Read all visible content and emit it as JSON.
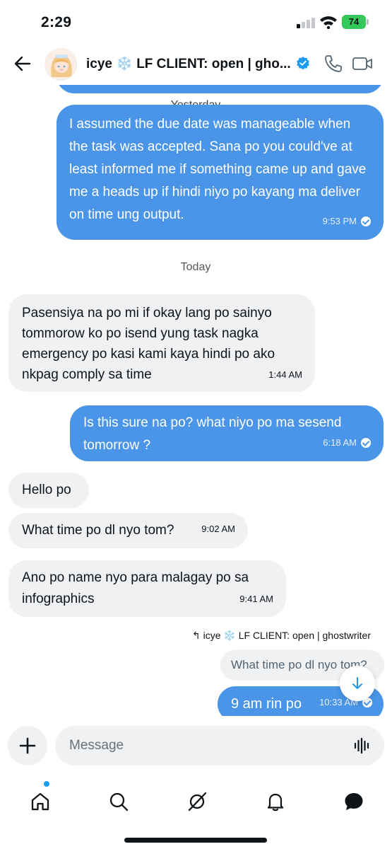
{
  "status": {
    "time": "2:29",
    "battery": "74"
  },
  "header": {
    "name": "icye ❄️ LF CLIENT: open | gho...",
    "back_label": "Back"
  },
  "dividers": {
    "yesterday": "Yesterday",
    "today": "Today"
  },
  "messages": [
    {
      "side": "out",
      "text": "I assumed the due date was manageable when the task was accepted. Sana po you could've at least informed me if something came up and gave me a heads up if hindi niyo po kayang ma deliver on time ung output.",
      "time": "9:53 PM"
    },
    {
      "side": "in",
      "text": "Pasensiya na po mi if okay lang po sainyo tommorow ko po isend yung task nagka emergency po kasi kami kaya hindi po ako nkpag comply sa time",
      "time": "1:44 AM"
    },
    {
      "side": "out",
      "text": "Is this sure na po? what niyo po ma sesend tomorrow ?",
      "time": "6:18 AM"
    },
    {
      "side": "in",
      "text": "Hello po",
      "time": ""
    },
    {
      "side": "in",
      "text": "What time po dl nyo tom?",
      "time": "9:02 AM"
    },
    {
      "side": "in",
      "text": "Ano po name nyo para malagay po sa infographics",
      "time": "9:41 AM"
    },
    {
      "side": "out",
      "text": "9 am rin po",
      "time": "10:33 AM"
    }
  ],
  "reply": {
    "label": "icye ❄️ LF CLIENT: open | ghostwriter",
    "quoted": "What time po dl nyo tom?"
  },
  "composer": {
    "placeholder": "Message"
  },
  "colors": {
    "outgoing": "#4a95e8",
    "incoming": "#eff1f3",
    "accent": "#1d9bf0",
    "battery": "#34c759"
  },
  "icons": [
    "back-arrow-icon",
    "verified-badge-icon",
    "phone-icon",
    "video-icon",
    "plus-icon",
    "voice-icon",
    "home-icon",
    "search-icon",
    "grok-icon",
    "bell-icon",
    "messages-icon",
    "arrow-down-icon"
  ]
}
